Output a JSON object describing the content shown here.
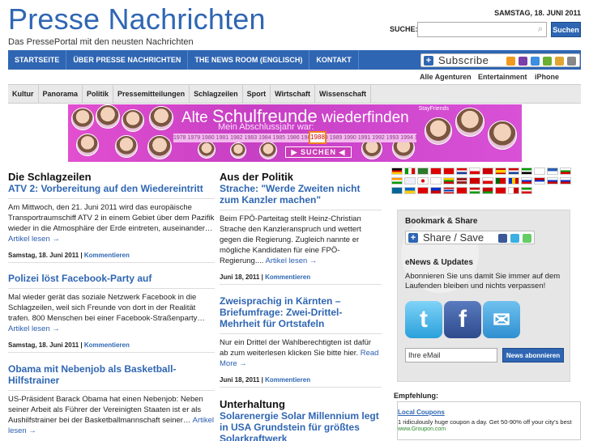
{
  "site": {
    "title": "Presse Nachrichten",
    "tagline": "Das PressePortal mit den neusten Nachrichten",
    "date": "SAMSTAG, 18. JUNI 2011"
  },
  "search": {
    "label": "SUCHE:",
    "button": "Suchen",
    "value": ""
  },
  "main_nav": [
    "STARTSEITE",
    "ÜBER PRESSE NACHRICHTEN",
    "THE NEWS ROOM (ENGLISCH)",
    "KONTAKT"
  ],
  "subscribe": {
    "label": "Subscribe"
  },
  "agencies": [
    "Alle Agenturen",
    "Entertainment",
    "iPhone"
  ],
  "categories": [
    "Kultur",
    "Panorama",
    "Politik",
    "Pressemitteilungen",
    "Schlagzeilen",
    "Sport",
    "Wirtschaft",
    "Wissenschaft"
  ],
  "banner": {
    "title_small": "Alte",
    "title_big": "Schulfreunde",
    "title_rest": "wiederfinden",
    "subtitle": "Mein Abschlussjahr war:",
    "years": "1978 1979 1980 1981 1982 1983 1984 1985 1986 1987 1988 1989 1990 1991 1992 1993 1994 1995",
    "selected_year": "1988",
    "button": "SUCHEN",
    "brand": "StayFriends"
  },
  "left_column": {
    "section_title": "Die Schlagzeilen",
    "articles": [
      {
        "headline": "ATV 2: Vorbereitung auf den Wiedereintritt",
        "text": "Am Mittwoch, den 21. Juni 2011 wird das europäische Transportraumschiff ATV 2 in einem Gebiet über dem Pazifik wieder in die Atmosphäre der Erde eintreten, auseinander…",
        "more": "Artikel lesen →",
        "date": "Samstag, 18. Juni 2011",
        "comments": "Kommentieren"
      },
      {
        "headline": "Polizei löst Facebook-Party auf",
        "text": "Mal wieder gerät das soziale Netzwerk Facebook in die Schlagzeilen, weil sich Freunde von dort in der Realität trafen. 800 Menschen bei einer Facebook-Straßenparty…",
        "more": "Artikel lesen →",
        "date": "Samstag, 18. Juni 2011",
        "comments": "Kommentieren"
      },
      {
        "headline": "Obama mit Nebenjob als Basketball-Hilfstrainer",
        "text": "US-Präsident Barack Obama hat einen Nebenjob: Neben seiner Arbeit als Führer der Vereinigten Staaten ist er als Aushilfstrainer bei der Basketballmannschaft seiner…",
        "more": "Artikel lesen →"
      }
    ]
  },
  "middle_column": {
    "section_title": "Aus der Politik",
    "articles": [
      {
        "headline": "Strache: \"Werde Zweiten nicht zum Kanzler machen\"",
        "text": "Beim FPÖ-Parteitag stellt Heinz-Christian Strache den Kanzleranspruch und wettert gegen die Regierung. Zugleich nannte er mögliche Kandidaten für eine FPÖ-Regierung....",
        "more": "Artikel lesen →",
        "date": "Juni 18, 2011",
        "comments": "Kommentieren"
      },
      {
        "headline": "Zweisprachig in Kärnten – Briefumfrage: Zwei-Drittel-Mehrheit für Ortstafeln",
        "text": "Nur ein Drittel der Wahlberechtigten ist dafür ab zum weiterlesen klicken Sie bitte hier.",
        "more": "Read More →",
        "date": "Juni 18, 2011",
        "comments": "Kommentieren"
      }
    ],
    "section2_title": "Unterhaltung",
    "section2_headline": "Solarenergie Solar Millennium legt in USA Grundstein für größtes Solarkraftwerk"
  },
  "sidebar": {
    "bookmark_title": "Bookmark & Share",
    "share_label": "Share / Save",
    "enews_title": "eNews & Updates",
    "enews_text": "Abonnieren Sie uns damit Sie immer auf dem Laufenden bleiben und nichts verpassen!",
    "social_icons": [
      "twitter-icon",
      "facebook-icon",
      "email-icon"
    ],
    "email_placeholder": "Ihre eMail",
    "subscribe_button": "News abonnieren"
  },
  "recommendation": {
    "label": "Empfehlung:",
    "link": "Local Coupons",
    "text": "1 ridiculously huge coupon a day. Get 50-90% off your city's best",
    "url": "www.Groupon.com"
  },
  "colors": {
    "brand": "#2f66b3",
    "banner": "#d04ccf"
  }
}
